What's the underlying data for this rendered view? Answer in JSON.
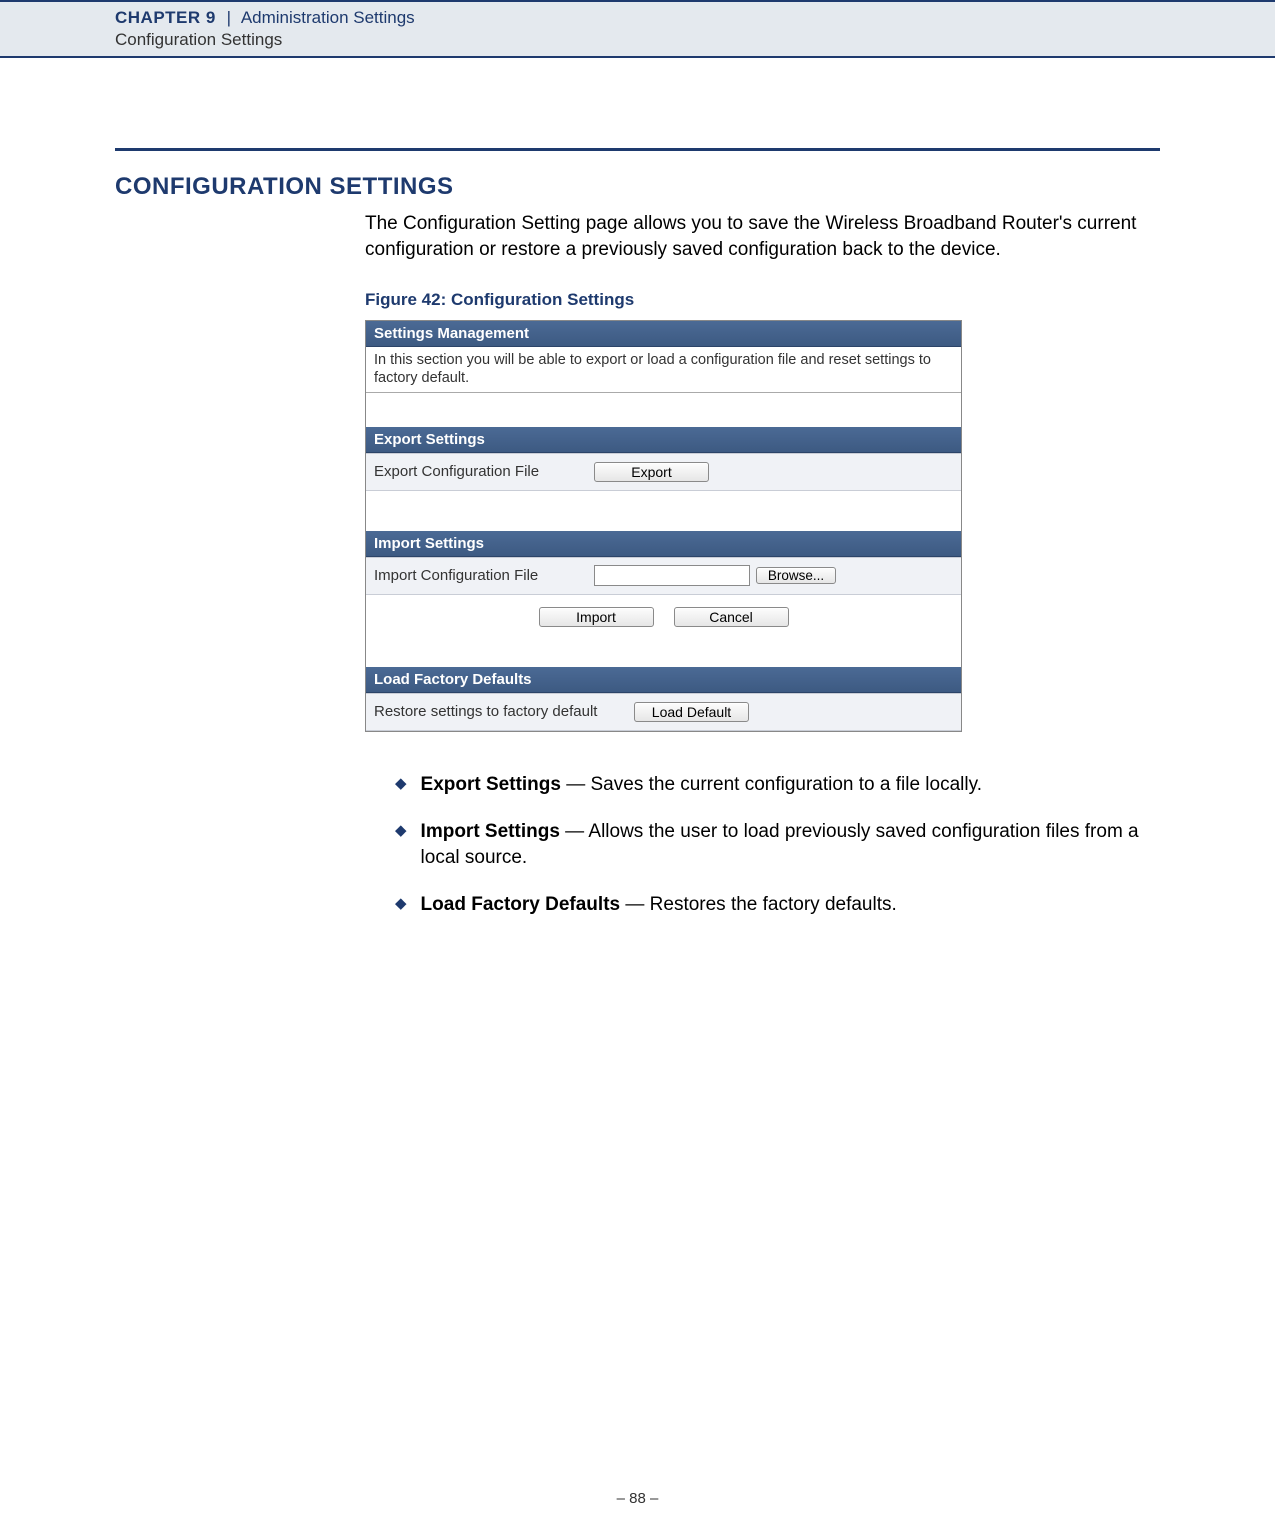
{
  "header": {
    "chapter": "CHAPTER 9",
    "divider": "|",
    "title": "Administration Settings",
    "subtitle": "Configuration Settings"
  },
  "section": {
    "title": "CONFIGURATION SETTINGS",
    "intro": "The Configuration Setting page allows you to save the Wireless Broadband Router's current configuration or restore a previously saved configuration back to the device.",
    "figure_caption": "Figure 42:  Configuration Settings"
  },
  "screenshot": {
    "panel1_header": "Settings Management",
    "panel1_desc": "In this section you will be able to export or load a configuration file and reset settings to factory default.",
    "panel2_header": "Export Settings",
    "export_label": "Export Configuration File",
    "export_btn": "Export",
    "panel3_header": "Import Settings",
    "import_label": "Import Configuration File",
    "browse_btn": "Browse...",
    "import_btn": "Import",
    "cancel_btn": "Cancel",
    "panel4_header": "Load Factory Defaults",
    "restore_label": "Restore settings to factory default",
    "load_default_btn": "Load Default"
  },
  "bullets": [
    {
      "term": "Export Settings",
      "desc": " — Saves the current configuration to a file locally."
    },
    {
      "term": "Import Settings",
      "desc": " — Allows the user to load previously saved configuration files from a local source."
    },
    {
      "term": "Load Factory Defaults",
      "desc": " — Restores the factory defaults."
    }
  ],
  "page_number": "–  88  –"
}
